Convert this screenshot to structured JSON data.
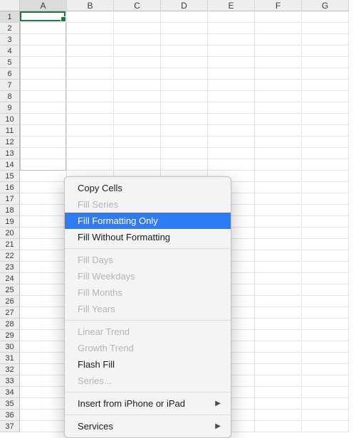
{
  "spreadsheet": {
    "columns": [
      "A",
      "B",
      "C",
      "D",
      "E",
      "F",
      "G"
    ],
    "visible_rows": 37,
    "active_cell": "A1",
    "active_column": "A",
    "active_row": 1,
    "fill_range": {
      "from_row": 2,
      "to_row": 14,
      "column": "A"
    }
  },
  "context_menu": {
    "groups": [
      [
        {
          "key": "copy_cells",
          "label": "Copy Cells",
          "enabled": true,
          "highlighted": false
        },
        {
          "key": "fill_series",
          "label": "Fill Series",
          "enabled": false,
          "highlighted": false
        },
        {
          "key": "fill_formatting_only",
          "label": "Fill Formatting Only",
          "enabled": true,
          "highlighted": true
        },
        {
          "key": "fill_without_formatting",
          "label": "Fill Without Formatting",
          "enabled": true,
          "highlighted": false
        }
      ],
      [
        {
          "key": "fill_days",
          "label": "Fill Days",
          "enabled": false,
          "highlighted": false
        },
        {
          "key": "fill_weekdays",
          "label": "Fill Weekdays",
          "enabled": false,
          "highlighted": false
        },
        {
          "key": "fill_months",
          "label": "Fill Months",
          "enabled": false,
          "highlighted": false
        },
        {
          "key": "fill_years",
          "label": "Fill Years",
          "enabled": false,
          "highlighted": false
        }
      ],
      [
        {
          "key": "linear_trend",
          "label": "Linear Trend",
          "enabled": false,
          "highlighted": false
        },
        {
          "key": "growth_trend",
          "label": "Growth Trend",
          "enabled": false,
          "highlighted": false
        },
        {
          "key": "flash_fill",
          "label": "Flash Fill",
          "enabled": true,
          "highlighted": false
        },
        {
          "key": "series",
          "label": "Series...",
          "enabled": false,
          "highlighted": false
        }
      ],
      [
        {
          "key": "insert_from_device",
          "label": "Insert from iPhone or iPad",
          "enabled": true,
          "highlighted": false,
          "submenu": true
        }
      ],
      [
        {
          "key": "services",
          "label": "Services",
          "enabled": true,
          "highlighted": false,
          "submenu": true
        }
      ]
    ]
  }
}
